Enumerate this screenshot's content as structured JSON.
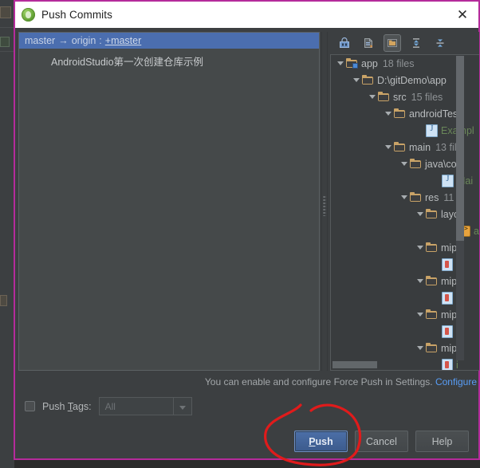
{
  "window": {
    "title": "Push Commits",
    "app_icon": "android-studio-icon",
    "close_label": "✕",
    "border_color": "#b52b9b"
  },
  "commits": {
    "header": {
      "source": "master",
      "arrow": "→",
      "remote": "origin",
      "separator": ":",
      "target": "+master",
      "selected": true
    },
    "items": [
      {
        "message": "AndroidStudio第一次创建仓库示例"
      }
    ]
  },
  "tree_toolbar": {
    "buttons": [
      {
        "name": "group-by-directory-icon",
        "label": "Group By Directory",
        "active": false
      },
      {
        "name": "group-by-module-icon",
        "label": "Group By Module",
        "active": false
      },
      {
        "name": "group-by-repository-icon",
        "label": "Group By Repository",
        "active": true
      },
      {
        "name": "expand-all-icon",
        "label": "Expand All",
        "active": false
      },
      {
        "name": "collapse-all-icon",
        "label": "Collapse All",
        "active": false
      }
    ]
  },
  "file_tree": {
    "nodes": [
      {
        "indent": 0,
        "expanded": true,
        "icon": "folder-module-icon",
        "label": "app",
        "count": "18 files",
        "type": "folder"
      },
      {
        "indent": 1,
        "expanded": true,
        "icon": "folder-icon",
        "label": "D:\\gitDemo\\app",
        "count": "",
        "type": "folder"
      },
      {
        "indent": 2,
        "expanded": true,
        "icon": "folder-icon",
        "label": "src",
        "count": "15 files",
        "type": "folder"
      },
      {
        "indent": 3,
        "expanded": true,
        "icon": "folder-icon",
        "label": "androidTes",
        "count": "",
        "type": "folder"
      },
      {
        "indent": 5,
        "expanded": false,
        "icon": "java-file-icon",
        "label": "Exampl",
        "count": "",
        "type": "java"
      },
      {
        "indent": 3,
        "expanded": true,
        "icon": "folder-icon",
        "label": "main",
        "count": "13 fil",
        "type": "folder"
      },
      {
        "indent": 4,
        "expanded": true,
        "icon": "folder-icon",
        "label": "java\\co",
        "count": "",
        "type": "folder"
      },
      {
        "indent": 6,
        "expanded": false,
        "icon": "java-file-icon",
        "label": "Mai",
        "count": "",
        "type": "java"
      },
      {
        "indent": 4,
        "expanded": true,
        "icon": "folder-icon",
        "label": "res",
        "count": "11",
        "type": "folder"
      },
      {
        "indent": 5,
        "expanded": true,
        "icon": "folder-icon",
        "label": "layo",
        "count": "",
        "type": "folder"
      },
      {
        "indent": 7,
        "expanded": false,
        "icon": "xml-file-icon",
        "label": "a",
        "count": "",
        "type": "xml"
      },
      {
        "indent": 5,
        "expanded": true,
        "icon": "folder-icon",
        "label": "mipr",
        "count": "",
        "type": "folder"
      },
      {
        "indent": 6,
        "expanded": false,
        "icon": "png-file-icon",
        "label": "i",
        "count": "",
        "type": "png"
      },
      {
        "indent": 5,
        "expanded": true,
        "icon": "folder-icon",
        "label": "mipr",
        "count": "",
        "type": "folder"
      },
      {
        "indent": 6,
        "expanded": false,
        "icon": "png-file-icon",
        "label": "i",
        "count": "",
        "type": "png"
      },
      {
        "indent": 5,
        "expanded": true,
        "icon": "folder-icon",
        "label": "mipr",
        "count": "",
        "type": "folder"
      },
      {
        "indent": 6,
        "expanded": false,
        "icon": "png-file-icon",
        "label": "i",
        "count": "",
        "type": "png"
      },
      {
        "indent": 5,
        "expanded": true,
        "icon": "folder-icon",
        "label": "mipr",
        "count": "",
        "type": "folder"
      },
      {
        "indent": 6,
        "expanded": false,
        "icon": "png-file-icon",
        "label": "i",
        "count": "",
        "type": "png"
      }
    ]
  },
  "force_push_hint": {
    "text": "You can enable and configure Force Push in Settings.",
    "link": "Configure"
  },
  "push_tags": {
    "checked": false,
    "label_before": "Push ",
    "label_mnemonic": "T",
    "label_after": "ags:",
    "dropdown_value": "All",
    "enabled": false
  },
  "buttons": {
    "push": {
      "label_mnemonic": "P",
      "label_rest": "ush",
      "primary": true
    },
    "cancel": {
      "label": "Cancel"
    },
    "help": {
      "label": "Help"
    }
  },
  "annotation": {
    "shape": "hand-drawn-circle",
    "color": "#e01b1b",
    "target": "push-button"
  }
}
